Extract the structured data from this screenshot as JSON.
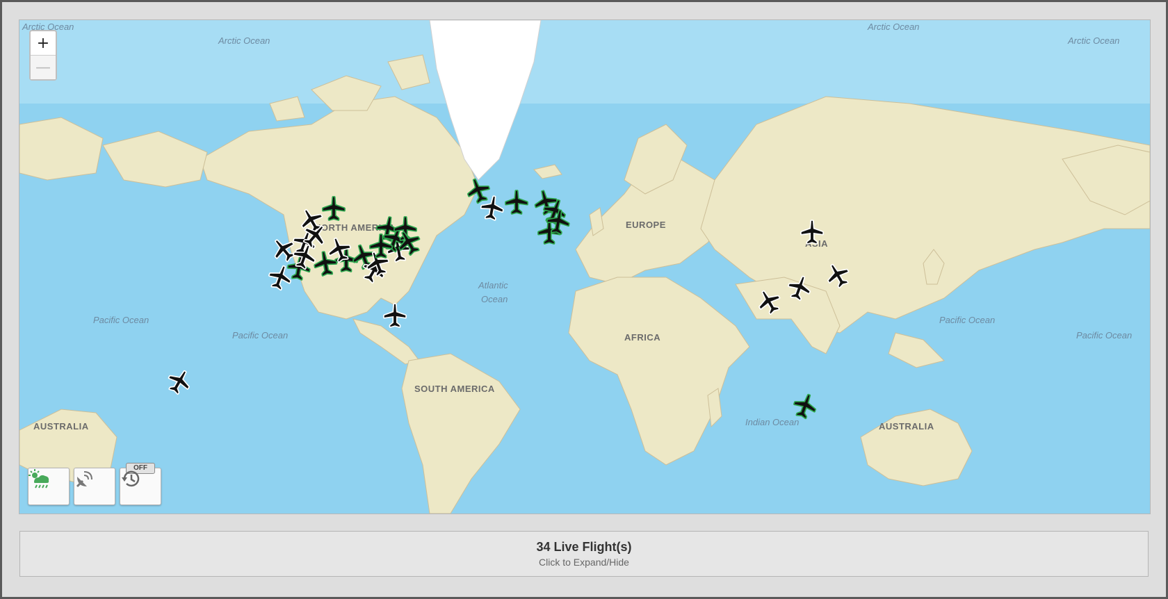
{
  "map": {
    "zoom_in": "+",
    "zoom_out": "—",
    "labels": [
      {
        "text": "Arctic Ocean",
        "kind": "ocean"
      },
      {
        "text": "Arctic Ocean",
        "kind": "ocean"
      },
      {
        "text": "Arctic Ocean",
        "kind": "ocean"
      },
      {
        "text": "Arctic Ocean",
        "kind": "ocean"
      },
      {
        "text": "NORTH AMERICA",
        "kind": "continent"
      },
      {
        "text": "EUROPE",
        "kind": "continent"
      },
      {
        "text": "ASIA",
        "kind": "continent"
      },
      {
        "text": "AFRICA",
        "kind": "continent"
      },
      {
        "text": "SOUTH AMERICA",
        "kind": "continent"
      },
      {
        "text": "AUSTRALIA",
        "kind": "continent"
      },
      {
        "text": "AUSTRALIA",
        "kind": "continent"
      },
      {
        "text": "Atlantic",
        "kind": "ocean"
      },
      {
        "text": "Ocean",
        "kind": "ocean"
      },
      {
        "text": "Pacific Ocean",
        "kind": "ocean"
      },
      {
        "text": "Pacific Ocean",
        "kind": "ocean"
      },
      {
        "text": "Pacific Ocean",
        "kind": "ocean"
      },
      {
        "text": "Pacific Ocean",
        "kind": "ocean"
      },
      {
        "text": "Indian Ocean",
        "kind": "ocean"
      }
    ],
    "flight_icons": [
      "airplane-icon-green",
      "airplane-icon-white"
    ],
    "colors": {
      "ocean": "#8fd2f0",
      "land": "#ece7c3",
      "green_plane": "#2fa84f",
      "white_plane": "#ffffff"
    }
  },
  "controls": {
    "weather": {
      "icon": "weather-radar-icon"
    },
    "tracking": {
      "icon": "satellite-dish-icon"
    },
    "history": {
      "icon": "history-icon",
      "badge": "OFF"
    }
  },
  "flights_panel": {
    "count_text": "34 Live Flight(s)",
    "hint": "Click to Expand/Hide"
  }
}
